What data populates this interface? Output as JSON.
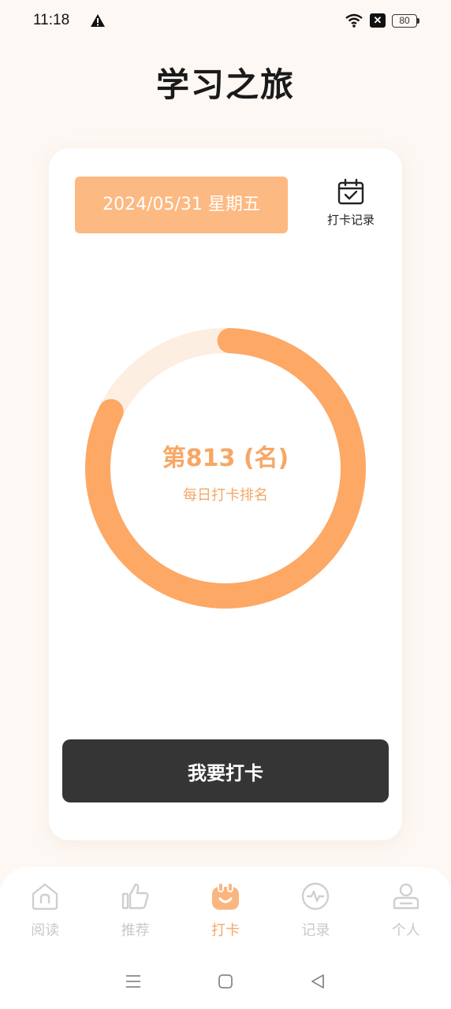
{
  "status": {
    "time": "11:18",
    "battery": "80"
  },
  "header": {
    "title": "学习之旅"
  },
  "card": {
    "date": "2024/05/31  星期五",
    "record_label": "打卡记录",
    "rank_text": "第813 (名)",
    "rank_label": "每日打卡排名",
    "checkin_button": "我要打卡"
  },
  "tabs": [
    {
      "label": "阅读",
      "icon": "home-icon"
    },
    {
      "label": "推荐",
      "icon": "thumbs-up-icon"
    },
    {
      "label": "打卡",
      "icon": "checkin-icon",
      "active": true
    },
    {
      "label": "记录",
      "icon": "activity-icon"
    },
    {
      "label": "个人",
      "icon": "user-icon"
    }
  ],
  "colors": {
    "accent": "#f7a764",
    "pill": "#fdb982",
    "ring_track": "#fdeee2",
    "button": "#353535"
  }
}
